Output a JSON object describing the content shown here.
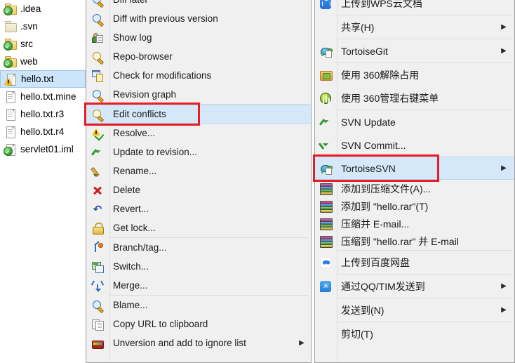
{
  "file_tree": {
    "name": "file-tree",
    "items": [
      {
        "label": ".idea",
        "icon": "folder-icon",
        "overlay": "svn-normal-check",
        "selected": false
      },
      {
        "label": ".svn",
        "icon": "folder-plain-icon",
        "overlay": "none",
        "selected": false
      },
      {
        "label": "src",
        "icon": "folder-icon",
        "overlay": "svn-normal-check",
        "selected": false
      },
      {
        "label": "web",
        "icon": "folder-icon",
        "overlay": "svn-normal-check",
        "selected": false
      },
      {
        "label": "hello.txt",
        "icon": "file-icon",
        "overlay": "svn-conflict-warning",
        "selected": true
      },
      {
        "label": "hello.txt.mine",
        "icon": "file-icon",
        "overlay": "none",
        "selected": false
      },
      {
        "label": "hello.txt.r3",
        "icon": "file-icon",
        "overlay": "none",
        "selected": false
      },
      {
        "label": "hello.txt.r4",
        "icon": "file-icon",
        "overlay": "none",
        "selected": false
      },
      {
        "label": "servlet01.iml",
        "icon": "file-icon",
        "overlay": "svn-normal-check",
        "selected": false
      }
    ]
  },
  "tortoise_submenu": {
    "name": "tortoisesvn-submenu",
    "highlighted_item": "Edit conflicts",
    "items": [
      {
        "label": "Diff later",
        "icon": "magnifier-icon",
        "arrow": false,
        "highlight": false,
        "sep_after": false,
        "clipped_top": true
      },
      {
        "label": "Diff with previous version",
        "icon": "magnifier-icon",
        "arrow": false,
        "highlight": false,
        "sep_after": false
      },
      {
        "label": "Show log",
        "icon": "show-log-icon",
        "arrow": false,
        "highlight": false,
        "sep_after": false
      },
      {
        "label": "Repo-browser",
        "icon": "repo-browser-icon",
        "arrow": false,
        "highlight": false,
        "sep_after": false
      },
      {
        "label": "Check for modifications",
        "icon": "check-modifications-icon",
        "arrow": false,
        "highlight": false,
        "sep_after": false
      },
      {
        "label": "Revision graph",
        "icon": "revision-graph-icon",
        "arrow": false,
        "highlight": false,
        "sep_after": true
      },
      {
        "label": "Edit conflicts",
        "icon": "edit-conflicts-icon",
        "arrow": false,
        "highlight": true,
        "sep_after": false
      },
      {
        "label": "Resolve...",
        "icon": "resolve-icon",
        "arrow": false,
        "highlight": false,
        "sep_after": false
      },
      {
        "label": "Update to revision...",
        "icon": "update-to-revision-icon",
        "arrow": false,
        "highlight": false,
        "sep_after": false
      },
      {
        "label": "Rename...",
        "icon": "rename-pencil-icon",
        "arrow": false,
        "highlight": false,
        "sep_after": false
      },
      {
        "label": "Delete",
        "icon": "delete-x-icon",
        "arrow": false,
        "highlight": false,
        "sep_after": false
      },
      {
        "label": "Revert...",
        "icon": "revert-arrow-icon",
        "arrow": false,
        "highlight": false,
        "sep_after": false
      },
      {
        "label": "Get lock...",
        "icon": "lock-icon",
        "arrow": false,
        "highlight": false,
        "sep_after": true
      },
      {
        "label": "Branch/tag...",
        "icon": "branch-tag-icon",
        "arrow": false,
        "highlight": false,
        "sep_after": false
      },
      {
        "label": "Switch...",
        "icon": "switch-icon",
        "arrow": false,
        "highlight": false,
        "sep_after": false
      },
      {
        "label": "Merge...",
        "icon": "merge-icon",
        "arrow": false,
        "highlight": false,
        "sep_after": true
      },
      {
        "label": "Blame...",
        "icon": "blame-icon",
        "arrow": false,
        "highlight": false,
        "sep_after": false
      },
      {
        "label": "Copy URL to clipboard",
        "icon": "copy-url-icon",
        "arrow": false,
        "highlight": false,
        "sep_after": false
      },
      {
        "label": "Unversion and add to ignore list",
        "icon": "ignore-list-icon",
        "arrow": true,
        "highlight": false,
        "sep_after": false
      }
    ]
  },
  "context_menu": {
    "name": "explorer-context-menu",
    "highlighted_item": "TortoiseSVN",
    "items": [
      {
        "label": "上传到WPS云文档",
        "icon": "wps-cloud-icon",
        "arrow": false,
        "highlight": false,
        "sep_after": true
      },
      {
        "label": "共享(H)",
        "icon": "none",
        "arrow": true,
        "highlight": false,
        "sep_after": true
      },
      {
        "label": "TortoiseGit",
        "icon": "tortoise-git-icon",
        "arrow": true,
        "highlight": false,
        "sep_after": true
      },
      {
        "label": "使用 360解除占用",
        "icon": "360-unlock-icon",
        "arrow": false,
        "highlight": false,
        "sep_after": false
      },
      {
        "label": "使用 360管理右键菜单",
        "icon": "360-manage-menu-icon",
        "arrow": false,
        "highlight": false,
        "sep_after": true
      },
      {
        "label": "SVN Update",
        "icon": "svn-update-icon",
        "arrow": false,
        "highlight": false,
        "sep_after": false
      },
      {
        "label": "SVN Commit...",
        "icon": "svn-commit-icon",
        "arrow": false,
        "highlight": false,
        "sep_after": false
      },
      {
        "label": "TortoiseSVN",
        "icon": "tortoise-svn-icon",
        "arrow": true,
        "highlight": true,
        "sep_after": false
      },
      {
        "label": "添加到压缩文件(A)...",
        "icon": "winrar-icon",
        "arrow": false,
        "highlight": false,
        "sep_after": false,
        "compact": true
      },
      {
        "label": "添加到 \"hello.rar\"(T)",
        "icon": "winrar-icon",
        "arrow": false,
        "highlight": false,
        "sep_after": false,
        "compact": true
      },
      {
        "label": "压缩并 E-mail...",
        "icon": "winrar-icon",
        "arrow": false,
        "highlight": false,
        "sep_after": false,
        "compact": true
      },
      {
        "label": "压缩到 \"hello.rar\" 并 E-mail",
        "icon": "winrar-icon",
        "arrow": false,
        "highlight": false,
        "sep_after": true,
        "compact": true
      },
      {
        "label": "上传到百度网盘",
        "icon": "baidu-netdisk-icon",
        "arrow": false,
        "highlight": false,
        "sep_after": true
      },
      {
        "label": "通过QQ/TIM发送到",
        "icon": "qq-tim-icon",
        "arrow": true,
        "highlight": false,
        "sep_after": true
      },
      {
        "label": "发送到(N)",
        "icon": "none",
        "arrow": true,
        "highlight": false,
        "sep_after": true
      },
      {
        "label": "剪切(T)",
        "icon": "none",
        "arrow": false,
        "highlight": false,
        "sep_after": false
      }
    ]
  },
  "annotations": {
    "name": "red-highlight-boxes",
    "color": "#ec1c24",
    "boxes": [
      {
        "target": "Edit conflicts"
      },
      {
        "target": "TortoiseSVN"
      }
    ]
  },
  "glyphs": {
    "submenu_arrow": "▶"
  }
}
